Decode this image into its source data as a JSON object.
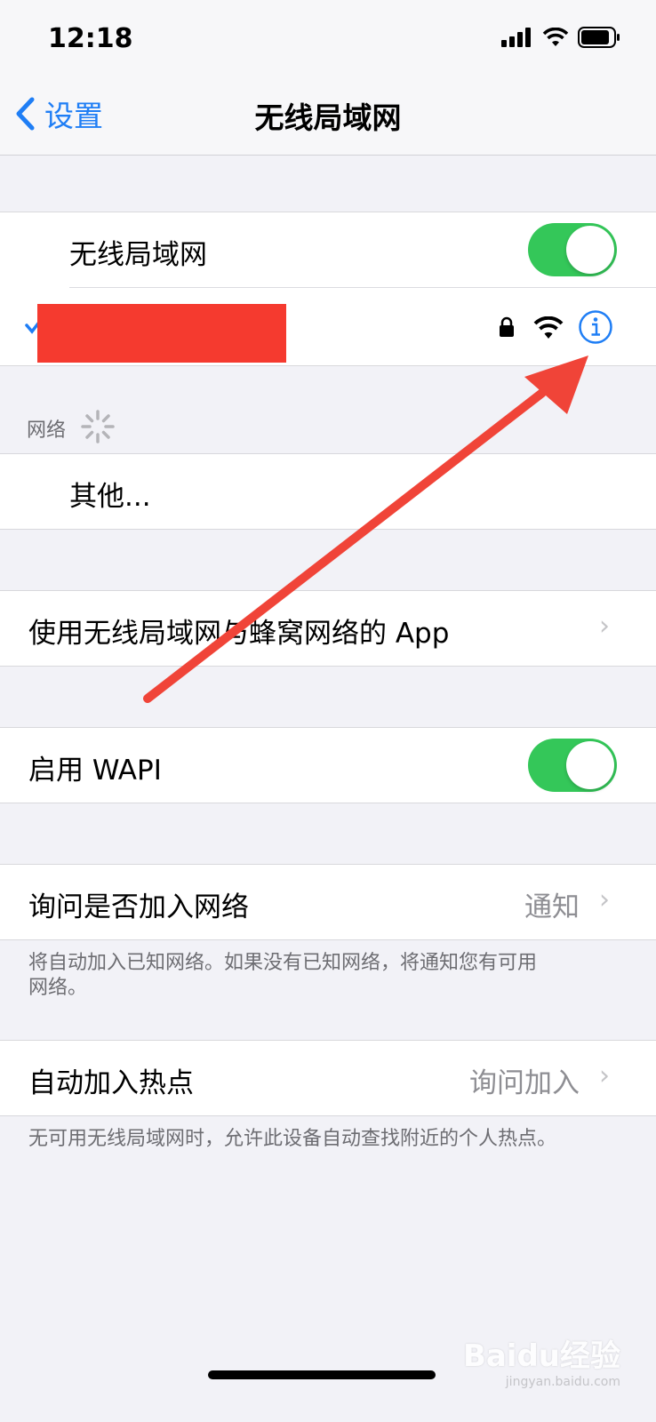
{
  "status_bar": {
    "time": "12:18"
  },
  "nav": {
    "back_label": "设置",
    "title": "无线局域网"
  },
  "wifi_toggle": {
    "label": "无线局域网",
    "on": true
  },
  "connected_network": {
    "name_redacted": true
  },
  "networks_section": {
    "header": "网络",
    "other_label": "其他..."
  },
  "apps_row": {
    "label": "使用无线局域网与蜂窝网络的 App"
  },
  "wapi_row": {
    "label": "启用 WAPI",
    "on": true
  },
  "ask_join_row": {
    "label": "询问是否加入网络",
    "value": "通知",
    "footer": "将自动加入已知网络。如果没有已知网络，将通知您有可用网络。"
  },
  "auto_hotspot_row": {
    "label": "自动加入热点",
    "value": "询问加入",
    "footer": "无可用无线局域网时，允许此设备自动查找附近的个人热点。"
  },
  "watermark": {
    "text": "Baidu经验",
    "sub": "jingyan.baidu.com"
  },
  "colors": {
    "accent": "#1f7ef5",
    "toggle_on": "#34c759",
    "annotation": "#f04438",
    "redaction": "#f53a2f"
  }
}
